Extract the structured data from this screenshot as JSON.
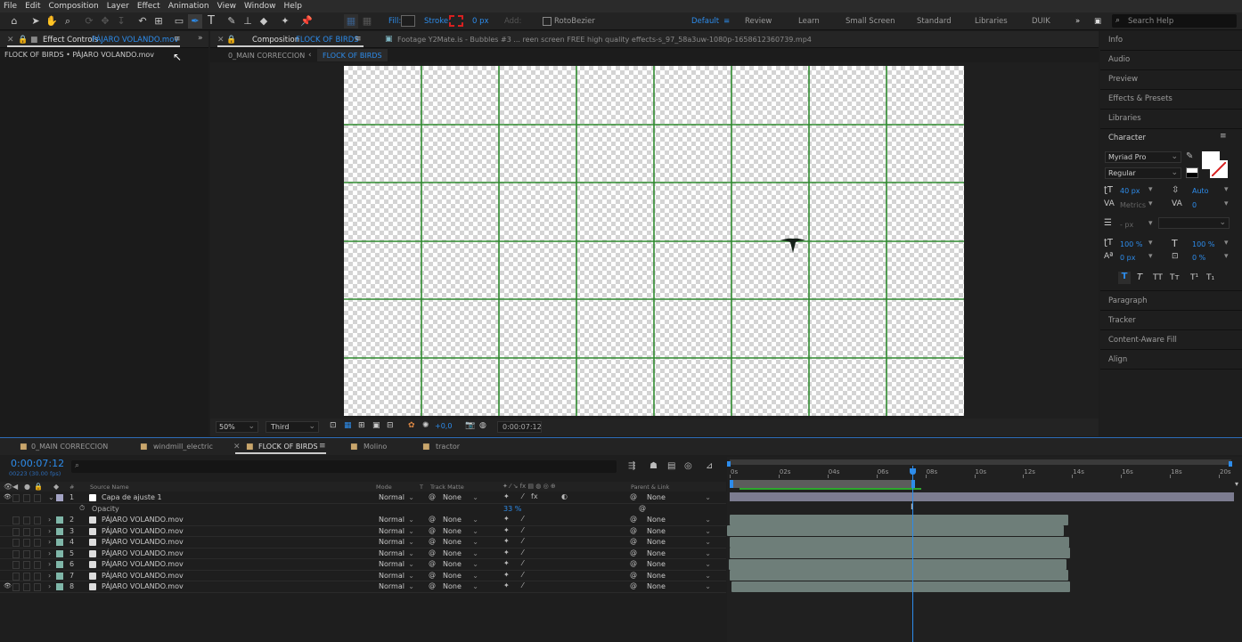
{
  "menu": [
    "File",
    "Edit",
    "Composition",
    "Layer",
    "Effect",
    "Animation",
    "View",
    "Window",
    "Help"
  ],
  "toolbar": {
    "fill_label": "Fill:",
    "stroke_label": "Stroke:",
    "stroke_px": "0 px",
    "add_label": "Add:",
    "rotobezier": "RotoBezier",
    "search_placeholder": "Search Help"
  },
  "workspaces": [
    "Default",
    "Review",
    "Learn",
    "Small Screen",
    "Standard",
    "Libraries",
    "DUIK"
  ],
  "effect_controls": {
    "tab_label": "Effect Controls",
    "tab_target": "PÁJARO VOLANDO.mov",
    "path": "FLOCK OF BIRDS • PÁJARO VOLANDO.mov"
  },
  "composition": {
    "tab_label": "Composition",
    "tab_name": "FLOCK OF BIRDS",
    "footage_label": "Footage Y2Mate.is - Bubbles #3 ... reen screen FREE high quality effects-s_97_58a3uw-1080p-1658612360739.mp4",
    "crumb1": "0_MAIN CORRECCION",
    "crumb2": "FLOCK OF BIRDS"
  },
  "viewer_footer": {
    "zoom": "50%",
    "resolution": "Third",
    "exposure": "+0,0",
    "timecode": "0:00:07:12"
  },
  "right_panel": {
    "items_top": [
      "Info",
      "Audio",
      "Preview",
      "Effects & Presets",
      "Libraries"
    ],
    "character_title": "Character",
    "font": "Myriad Pro",
    "style": "Regular",
    "size": "40 px",
    "leading": "Auto",
    "kerning": "Metrics",
    "tracking": "0",
    "stroke_px": "- px",
    "vscale": "100 %",
    "hscale": "100 %",
    "baseline": "0 px",
    "tsume": "0 %",
    "type_styles": [
      "T",
      "T",
      "TT",
      "Tт",
      "T¹",
      "T₁"
    ],
    "items_bottom": [
      "Paragraph",
      "Tracker",
      "Content-Aware Fill",
      "Align"
    ]
  },
  "timeline": {
    "tabs": [
      "0_MAIN CORRECCION",
      "windmill_electric",
      "FLOCK OF BIRDS",
      "Molino",
      "tractor"
    ],
    "time": "0:00:07:12",
    "frames": "00223 (30.00 fps)",
    "headers": {
      "num": "#",
      "source": "Source Name",
      "mode": "Mode",
      "t": "T",
      "track": "Track Matte",
      "parent": "Parent & Link"
    },
    "ruler": [
      "0s",
      "02s",
      "04s",
      "06s",
      "08s",
      "10s",
      "12s",
      "14s",
      "16s",
      "18s",
      "20s"
    ],
    "layers": [
      {
        "num": "1",
        "name": "Capa de ajuste 1",
        "mode": "Normal",
        "track": "None",
        "parent": "None"
      },
      {
        "num": "2",
        "name": "PÁJARO VOLANDO.mov",
        "mode": "Normal",
        "track": "None",
        "parent": "None"
      },
      {
        "num": "3",
        "name": "PÁJARO VOLANDO.mov",
        "mode": "Normal",
        "track": "None",
        "parent": "None"
      },
      {
        "num": "4",
        "name": "PÁJARO VOLANDO.mov",
        "mode": "Normal",
        "track": "None",
        "parent": "None"
      },
      {
        "num": "5",
        "name": "PÁJARO VOLANDO.mov",
        "mode": "Normal",
        "track": "None",
        "parent": "None"
      },
      {
        "num": "6",
        "name": "PÁJARO VOLANDO.mov",
        "mode": "Normal",
        "track": "None",
        "parent": "None"
      },
      {
        "num": "7",
        "name": "PÁJARO VOLANDO.mov",
        "mode": "Normal",
        "track": "None",
        "parent": "None"
      },
      {
        "num": "8",
        "name": "PÁJARO VOLANDO.mov",
        "mode": "Normal",
        "track": "None",
        "parent": "None"
      }
    ],
    "opacity_label": "Opacity",
    "opacity_value": "33"
  },
  "colors": {
    "accent": "#2d8ceb",
    "grid": "#2f8a2f",
    "stroke_swatch": "#d82020"
  }
}
